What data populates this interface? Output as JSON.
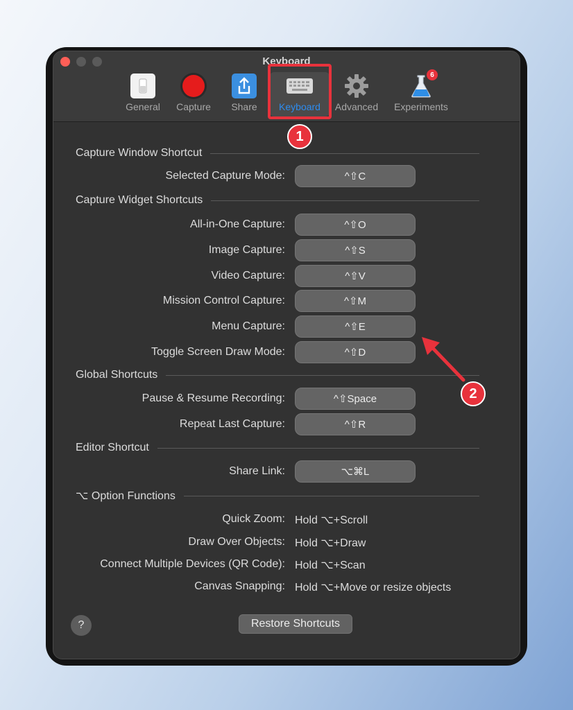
{
  "window": {
    "title": "Keyboard"
  },
  "toolbar": {
    "items": [
      {
        "label": "General",
        "icon": "toggle-switch-icon"
      },
      {
        "label": "Capture",
        "icon": "record-circle-icon"
      },
      {
        "label": "Share",
        "icon": "share-icon"
      },
      {
        "label": "Keyboard",
        "icon": "keyboard-icon",
        "selected": true
      },
      {
        "label": "Advanced",
        "icon": "gear-icon"
      },
      {
        "label": "Experiments",
        "icon": "flask-icon",
        "badge": "6"
      }
    ]
  },
  "annotations": {
    "step1": "1",
    "step2": "2",
    "color": "#e8323c"
  },
  "sections": {
    "capture_window": {
      "title": "Capture Window Shortcut",
      "rows": [
        {
          "label": "Selected Capture Mode:",
          "shortcut": "^⇧C"
        }
      ]
    },
    "capture_widget": {
      "title": "Capture Widget Shortcuts",
      "rows": [
        {
          "label": "All-in-One Capture:",
          "shortcut": "^⇧O"
        },
        {
          "label": "Image Capture:",
          "shortcut": "^⇧S"
        },
        {
          "label": "Video Capture:",
          "shortcut": "^⇧V"
        },
        {
          "label": "Mission Control Capture:",
          "shortcut": "^⇧M"
        },
        {
          "label": "Menu Capture:",
          "shortcut": "^⇧E"
        },
        {
          "label": "Toggle Screen Draw Mode:",
          "shortcut": "^⇧D"
        }
      ]
    },
    "global": {
      "title": "Global Shortcuts",
      "rows": [
        {
          "label": "Pause & Resume Recording:",
          "shortcut": "^⇧Space"
        },
        {
          "label": "Repeat Last Capture:",
          "shortcut": "^⇧R"
        }
      ]
    },
    "editor": {
      "title": "Editor Shortcut",
      "rows": [
        {
          "label": "Share Link:",
          "shortcut": "⌥⌘L"
        }
      ]
    },
    "option": {
      "title": "⌥ Option Functions",
      "rows": [
        {
          "label": "Quick Zoom:",
          "value": "Hold ⌥+Scroll"
        },
        {
          "label": "Draw Over Objects:",
          "value": "Hold ⌥+Draw"
        },
        {
          "label": "Connect Multiple Devices (QR Code):",
          "value": "Hold ⌥+Scan"
        },
        {
          "label": "Canvas Snapping:",
          "value": "Hold ⌥+Move or resize objects"
        }
      ]
    }
  },
  "footer": {
    "help_label": "?",
    "restore_label": "Restore Shortcuts"
  }
}
